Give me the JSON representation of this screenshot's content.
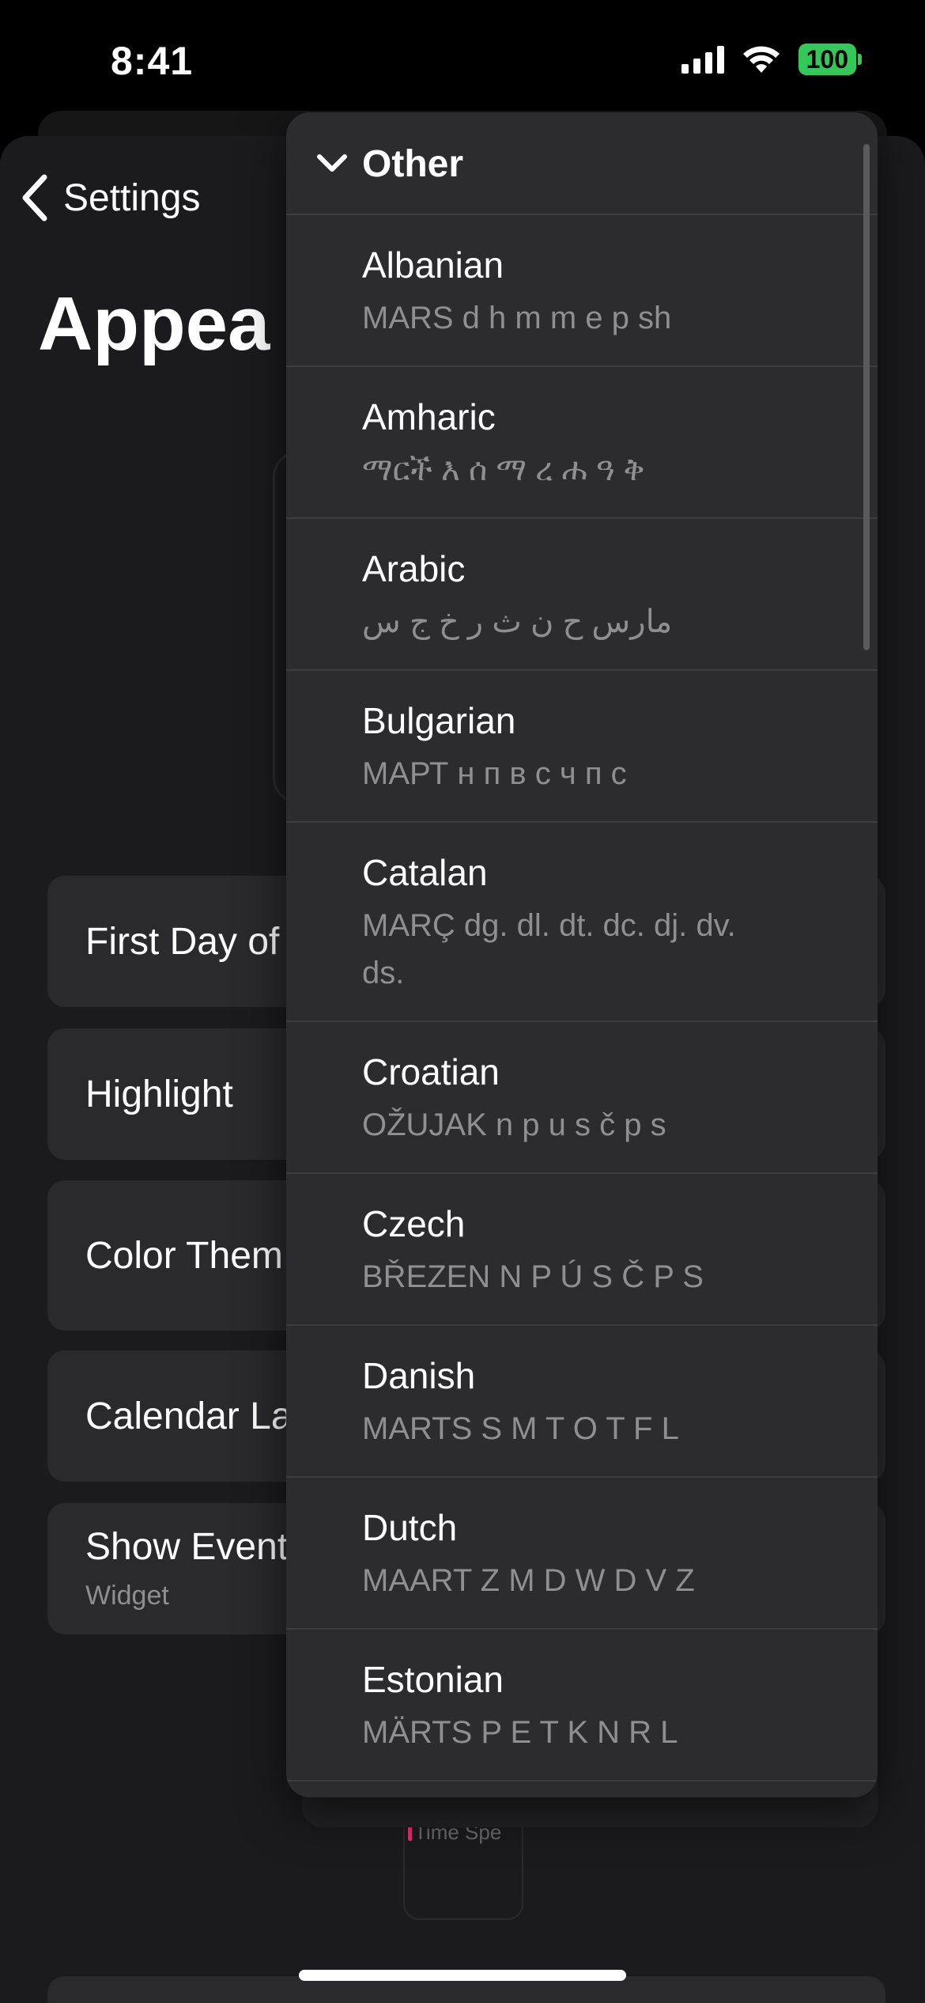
{
  "status_bar": {
    "time": "8:41",
    "battery": "100",
    "icons": [
      "cellular-signal-icon",
      "wifi-icon",
      "battery-icon"
    ]
  },
  "nav": {
    "back_label": "Settings",
    "title": "Appea"
  },
  "settings_rows": [
    {
      "label": "First Day of"
    },
    {
      "label": "Highlight"
    },
    {
      "label": "Color Them"
    },
    {
      "label": "Calendar La"
    },
    {
      "label": "Show Event",
      "sublabel": "Widget"
    }
  ],
  "widget_preview": {
    "label": "Time Spe"
  },
  "menu": {
    "header": "Other",
    "items": [
      {
        "name": "Albanian",
        "sample": "MARS d h m m e p sh"
      },
      {
        "name": "Amharic",
        "sample": "ማርች እ ሰ ማ ረ ሐ ዓ ቅ"
      },
      {
        "name": "Arabic",
        "sample": "مارس ح ن ث ر خ ج س"
      },
      {
        "name": "Bulgarian",
        "sample": "МАРТ н п в с ч п с"
      },
      {
        "name": "Catalan",
        "sample": "MARÇ dg. dl. dt. dc. dj. dv. ds."
      },
      {
        "name": "Croatian",
        "sample": "OŽUJAK n p u s č p s"
      },
      {
        "name": "Czech",
        "sample": "BŘEZEN N P Ú S Č P S"
      },
      {
        "name": "Danish",
        "sample": "MARTS S M T O T F L"
      },
      {
        "name": "Dutch",
        "sample": "MAART Z M D W D V Z"
      },
      {
        "name": "Estonian",
        "sample": "MÄRTS P E T K N R L"
      }
    ]
  },
  "colors": {
    "background": "#000000",
    "sheet": "#1b1b1d",
    "menu": "#2c2c2e",
    "separator": "#3d3d40",
    "secondary_text": "#8e8e93",
    "battery": "#34c759",
    "accent_pink": "#e5306b"
  }
}
